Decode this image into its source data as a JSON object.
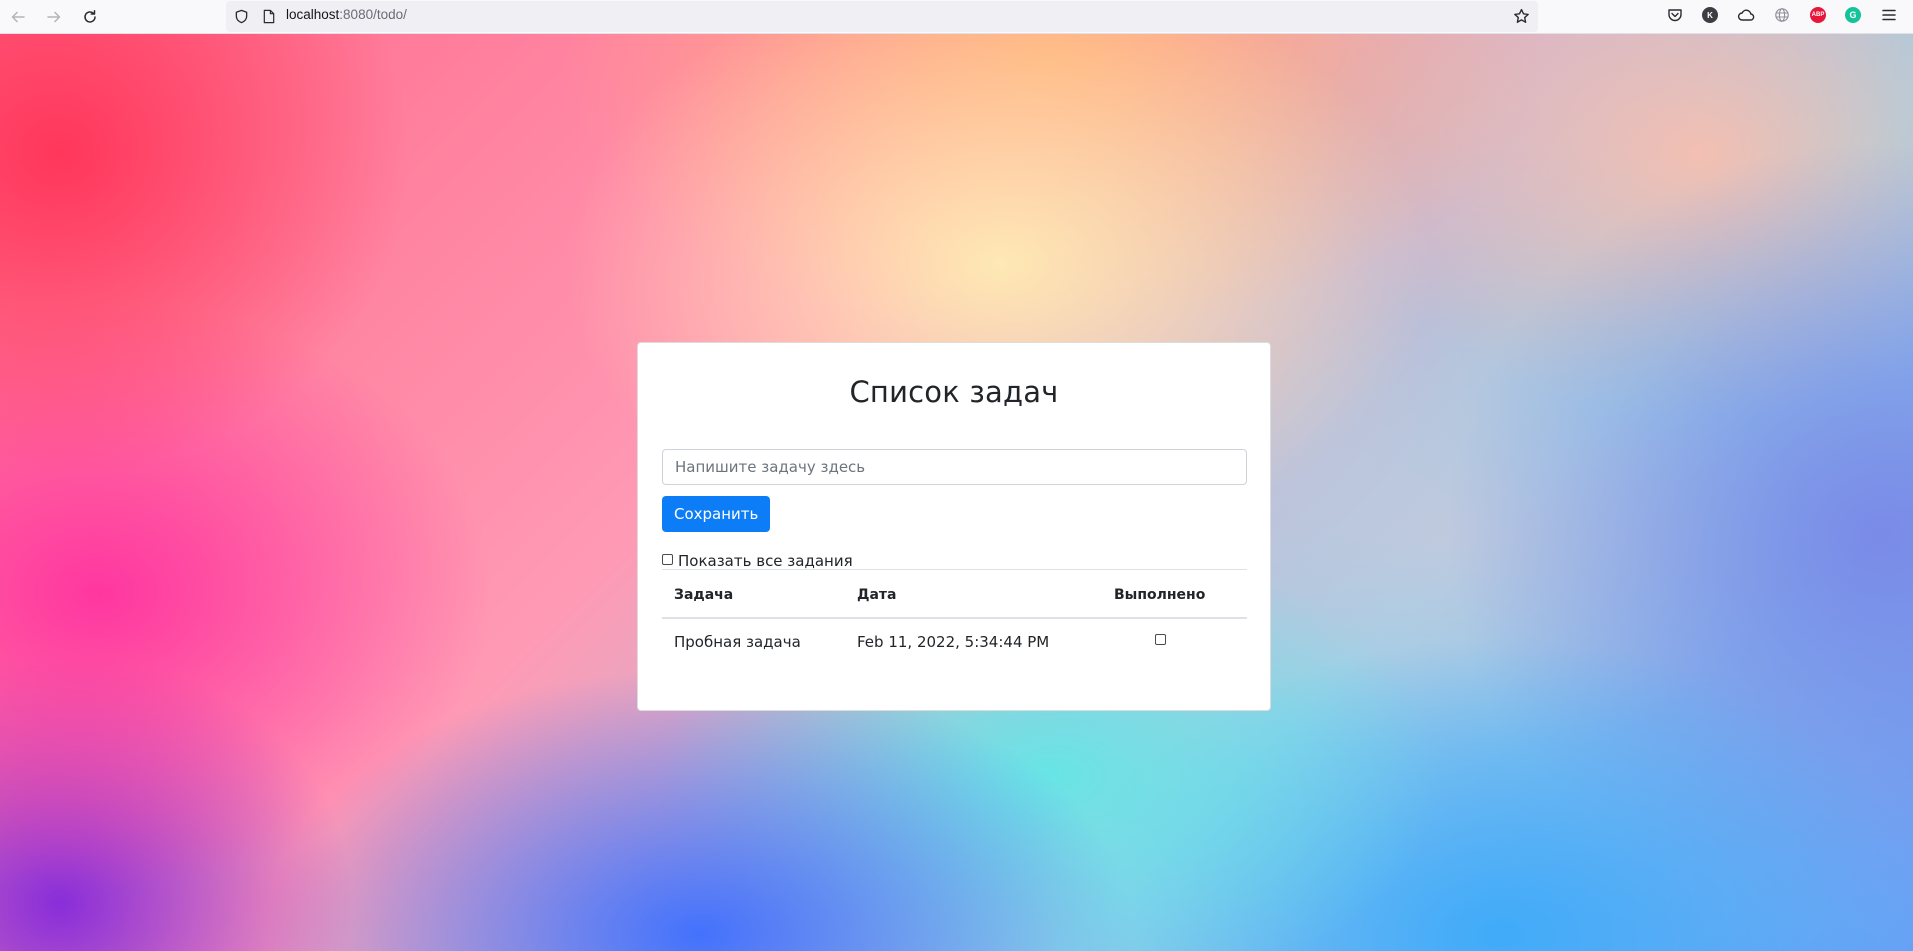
{
  "browser": {
    "url_host": "localhost",
    "url_rest": ":8080/todo/",
    "extensions": [
      {
        "name": "pocket-icon"
      },
      {
        "name": "k-extension-icon",
        "label": "K",
        "color": "#3d3d44"
      },
      {
        "name": "cloud-icon"
      },
      {
        "name": "globe-icon"
      },
      {
        "name": "adblock-icon",
        "label": "ABP",
        "color": "#e8173a"
      },
      {
        "name": "grammarly-icon",
        "label": "G",
        "color": "#15c39a"
      }
    ]
  },
  "todo": {
    "title": "Список задач",
    "input_placeholder": "Напишите задачу здесь",
    "save_label": "Сохранить",
    "show_all_label": "Показать все задания",
    "columns": [
      "Задача",
      "Дата",
      "Выполнено"
    ],
    "rows": [
      {
        "task": "Пробная задача",
        "date": "Feb 11, 2022, 5:34:44 PM",
        "done": false
      }
    ]
  }
}
